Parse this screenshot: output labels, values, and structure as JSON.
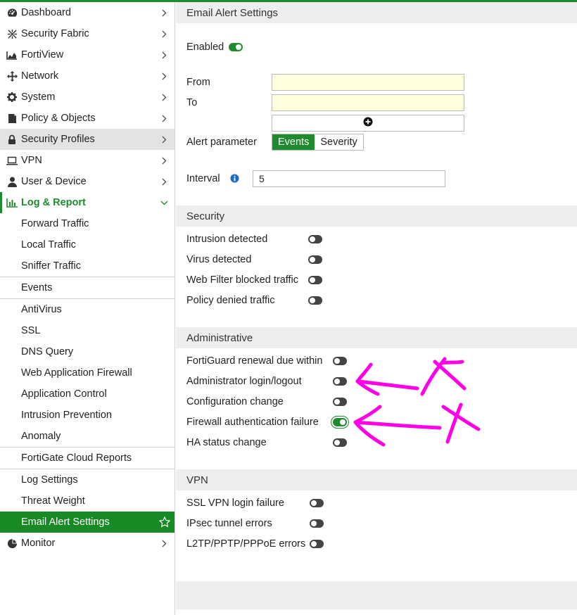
{
  "sidebar": {
    "items": [
      {
        "label": "Dashboard",
        "icon": "dashboard-icon"
      },
      {
        "label": "Security Fabric",
        "icon": "security-fabric-icon"
      },
      {
        "label": "FortiView",
        "icon": "fortiview-icon"
      },
      {
        "label": "Network",
        "icon": "network-icon"
      },
      {
        "label": "System",
        "icon": "gear-icon"
      },
      {
        "label": "Policy & Objects",
        "icon": "policy-icon"
      },
      {
        "label": "Security Profiles",
        "icon": "lock-icon"
      },
      {
        "label": "VPN",
        "icon": "laptop-icon"
      },
      {
        "label": "User & Device",
        "icon": "user-icon"
      },
      {
        "label": "Log & Report",
        "icon": "bar-chart-icon"
      }
    ],
    "log_report_sub": [
      "Forward Traffic",
      "Local Traffic",
      "Sniffer Traffic",
      "Events",
      "AntiVirus",
      "SSL",
      "DNS Query",
      "Web Application Firewall",
      "Application Control",
      "Intrusion Prevention",
      "Anomaly",
      "FortiGate Cloud Reports",
      "Log Settings",
      "Threat Weight",
      "Email Alert Settings"
    ],
    "monitor": "Monitor"
  },
  "main": {
    "title": "Email Alert Settings",
    "enabled_label": "Enabled",
    "enabled": true,
    "from_label": "From",
    "from_value": "",
    "to_label": "To",
    "to_value": "",
    "alert_parameter_label": "Alert parameter",
    "alert_parameter_options": [
      "Events",
      "Severity"
    ],
    "alert_parameter_selected": "Events",
    "interval_label": "Interval",
    "interval_value": "5",
    "security": {
      "title": "Security",
      "items": [
        {
          "label": "Intrusion detected",
          "on": false
        },
        {
          "label": "Virus detected",
          "on": false
        },
        {
          "label": "Web Filter blocked traffic",
          "on": false
        },
        {
          "label": "Policy denied traffic",
          "on": false
        }
      ]
    },
    "administrative": {
      "title": "Administrative",
      "items": [
        {
          "label": "FortiGuard renewal due within",
          "on": false
        },
        {
          "label": "Administrator login/logout",
          "on": false
        },
        {
          "label": "Configuration change",
          "on": false
        },
        {
          "label": "Firewall authentication failure",
          "on": true
        },
        {
          "label": "HA status change",
          "on": false
        }
      ]
    },
    "vpn": {
      "title": "VPN",
      "items": [
        {
          "label": "SSL VPN login failure",
          "on": false
        },
        {
          "label": "IPsec tunnel errors",
          "on": false
        },
        {
          "label": "L2TP/PPTP/PPPoE errors",
          "on": false
        }
      ]
    }
  },
  "colors": {
    "accent": "#1e8c2e",
    "annotation": "#ff00e6"
  }
}
